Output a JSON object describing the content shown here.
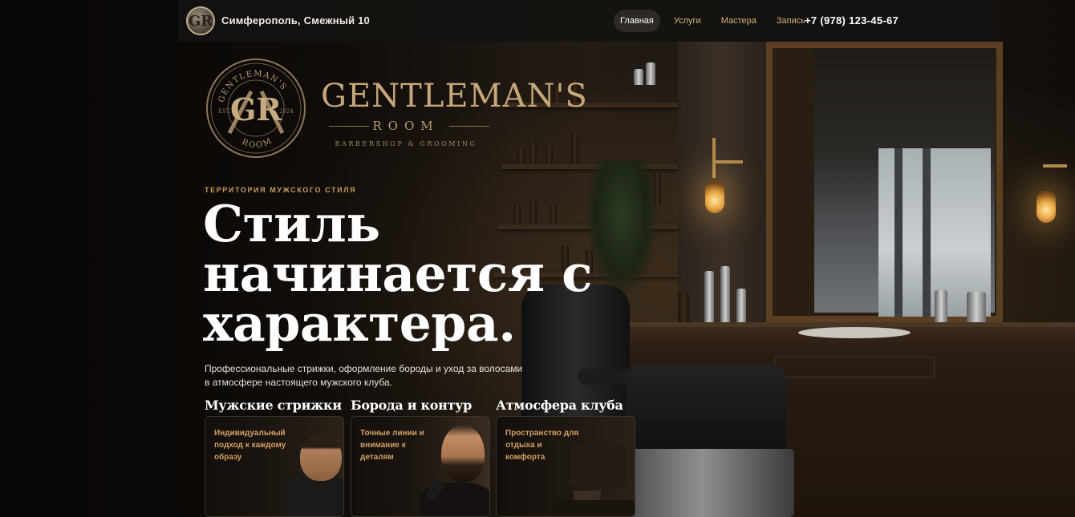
{
  "header": {
    "logo_letters": "GR",
    "address": "Симферополь, Смежный 10",
    "nav": [
      {
        "label": "Главная",
        "active": true
      },
      {
        "label": "Услуги",
        "active": false
      },
      {
        "label": "Мастера",
        "active": false
      },
      {
        "label": "Запись",
        "active": false
      }
    ],
    "phone": "+7 (978) 123-45-67"
  },
  "brand": {
    "emblem_top": "GENTLEMAN'S",
    "emblem_letters": "GR",
    "emblem_est": "EST.",
    "emblem_year": "2024",
    "emblem_bottom": "ROOM",
    "title": "GENTLEMAN'S",
    "room": "ROOM",
    "subtitle": "BARBERSHOP & GROOMING"
  },
  "hero": {
    "eyebrow": "ТЕРРИТОРИЯ МУЖСКОГО СТИЛЯ",
    "title_lines": [
      "Стиль",
      "начинается с",
      "характера."
    ],
    "description": "Профессиональные стрижки, оформление бороды и уход за волосами в атмосфере настоящего мужского клуба."
  },
  "features": [
    {
      "title": "Мужские стрижки",
      "text": "Индивидуальный подход к каждому образу"
    },
    {
      "title": "Борода и контур",
      "text": "Точные линии и внимание к деталям"
    },
    {
      "title": "Атмосфера клуба",
      "text": "Пространство для отдыха и комфорта"
    }
  ],
  "colors": {
    "accent_gold": "#c99d5c",
    "brand_gold": "#c7a87a",
    "header_bg": "#141210",
    "nav_active_bg": "#2d2a26"
  }
}
